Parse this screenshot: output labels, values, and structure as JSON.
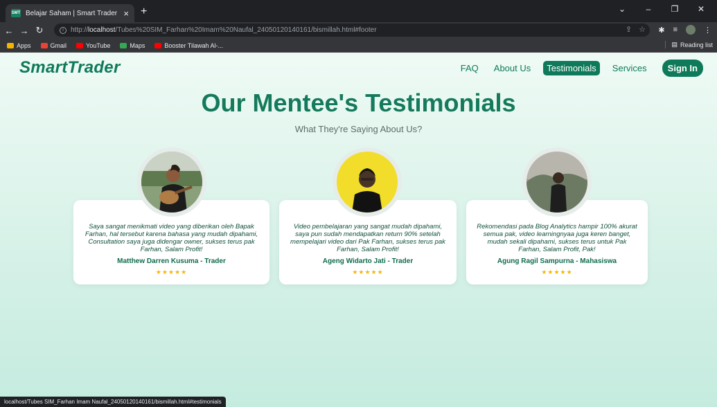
{
  "browser": {
    "tab_favicon_text": "SMT",
    "tab_title": "Belajar Saham | Smart Trader",
    "tab_close": "×",
    "new_tab": "+",
    "url_prefix": "http://",
    "url_host": "localhost",
    "url_path": "/Tubes%20SIM_Farhan%20Imam%20Naufal_24050120140161/bismillah.html#footer",
    "bookmarks": [
      {
        "label": "Apps",
        "color": "#f4b400"
      },
      {
        "label": "Gmail",
        "color": "#ea4335"
      },
      {
        "label": "YouTube",
        "color": "#ff0000"
      },
      {
        "label": "Maps",
        "color": "#34a853"
      },
      {
        "label": "Booster Tilawah Al-...",
        "color": "#ff0000"
      }
    ],
    "reading_list": "Reading list",
    "status_url": "localhost/Tubes SIM_Farhan Imam Naufal_24050120140161/bismillah.html#testimonials"
  },
  "nav": {
    "logo": "SmartTrader",
    "links": [
      "FAQ",
      "About Us",
      "Testimonials",
      "Services"
    ],
    "active_index": 2,
    "signin": "Sign In"
  },
  "hero": {
    "title": "Our Mentee's Testimonials",
    "subtitle": "What They're Saying About Us?"
  },
  "testimonials": [
    {
      "quote": "Saya sangat menikmati video yang diberikan oleh Bapak Farhan, hal tersebut karena bahasa yang mudah dipahami, Consultation saya juga didengar owner, sukses terus pak Farhan, Salam Profit!",
      "author": "Matthew Darren Kusuma - Trader",
      "rating": 5,
      "stars": "★★★★★"
    },
    {
      "quote": "Video pembelajaran yang sangat mudah dipahami, saya pun sudah mendapatkan return 90% setelah mempelajari video dari Pak Farhan, sukses terus pak Farhan, Salam Profit!",
      "author": "Ageng Widarto Jati - Trader",
      "rating": 5,
      "stars": "★★★★★"
    },
    {
      "quote": "Rekomendasi pada Blog Analytics hampir 100% akurat semua pak, video learningnyaa juga keren banget, mudah sekali dipahami, sukses terus untuk Pak Farhan, Salam Profit, Pak!",
      "author": "Agung Ragil Sampurna - Mahasiswa",
      "rating": 5,
      "stars": "★★★★★"
    }
  ],
  "colors": {
    "brand": "#0f7a59",
    "star": "#f2b705"
  }
}
